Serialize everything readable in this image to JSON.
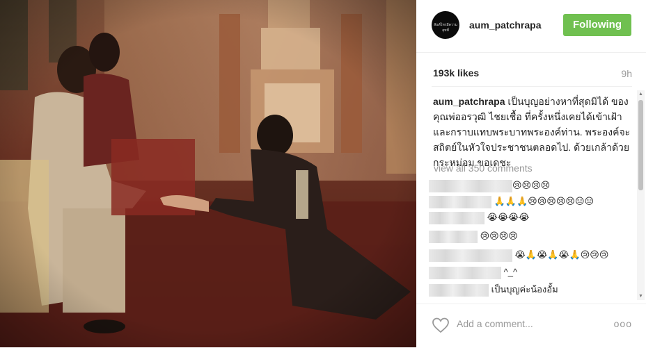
{
  "post": {
    "username": "aum_patchrapa",
    "avatar_text": "สันต์ไทรมีความสุขที่",
    "follow_label": "Following",
    "likes": "193k likes",
    "time": "9h",
    "caption_user": "aum_patchrapa",
    "caption_text": " เป็นบุญอย่างหาที่สุดมิได้ ของ คุณพ่ออรวุฒิ ไชยเชื้อ ที่ครั้งหนึ่งเคยได้เข้าเฝ้าและกราบแทบพระบาทพระองค์ท่าน. พระองค์จะสถิตย์ในหัวใจประชาชนตลอดไป. ด้วยเกล้าด้วยกระหม่อม ขอเดชะ",
    "view_all": "view all 350 comments",
    "add_comment_placeholder": "Add a comment...",
    "more_label": "ooo"
  },
  "comments": [
    {
      "text": "😢😢😢😢"
    },
    {
      "text": "🙏🙏🙏😢😢😢😢😢😑😑"
    },
    {
      "text": "😭😭😭😭"
    },
    {
      "text": "😢😢😢😢"
    },
    {
      "text": "😭🙏😭🙏😭🙏😢😢😢"
    },
    {
      "text": "^_^"
    },
    {
      "text": "เป็นบุญค่ะน้องอั้ม"
    }
  ],
  "colors": {
    "follow_bg": "#70c050",
    "muted": "#999999",
    "text": "#262626"
  },
  "icons": {
    "like": "heart-icon",
    "scroll_up": "arrow-up-icon",
    "scroll_down": "arrow-down-icon"
  }
}
